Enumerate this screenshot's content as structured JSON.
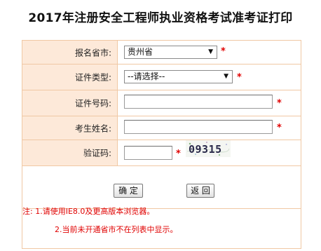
{
  "page": {
    "title": "2017年注册安全工程师执业资格考试准考证打印"
  },
  "form": {
    "province": {
      "label": "报名省市:",
      "value": "贵州省"
    },
    "id_type": {
      "label": "证件类型:",
      "value": "--请选择--"
    },
    "id_number": {
      "label": "证件号码:",
      "value": ""
    },
    "name": {
      "label": "考生姓名:",
      "value": ""
    },
    "captcha": {
      "label": "验证码:",
      "value": "",
      "image_text": "09315"
    },
    "required_mark": "*"
  },
  "buttons": {
    "confirm": "确 定",
    "back": "返 回"
  },
  "notes": {
    "line1": "注: 1.请使用IE8.0及更高版本浏览器。",
    "line2": "2.当前未开通省市不在列表中显示。"
  },
  "colors": {
    "label_bg": "#fde9d9",
    "border": "#f0c8a4",
    "required": "#e00000",
    "note_text": "#e00000"
  }
}
